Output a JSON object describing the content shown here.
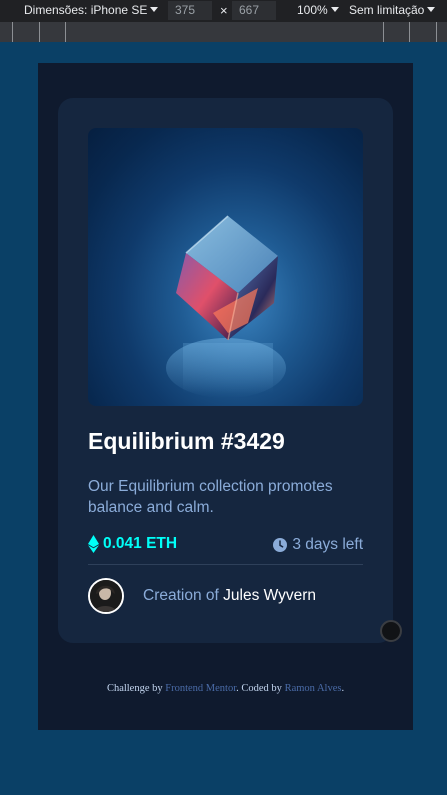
{
  "toolbar": {
    "dimensions_label": "Dimensões: iPhone SE",
    "width_value": "375",
    "times_symbol": "×",
    "height_value": "667",
    "zoom_label": "100%",
    "throttle_label": "Sem limitação"
  },
  "card": {
    "title": "Equilibrium #3429",
    "description": "Our Equilibrium collection promotes balance and calm.",
    "price": "0.041 ETH",
    "time_left": "3 days left",
    "creator_prefix": "Creation of",
    "creator_name": "Jules Wyvern"
  },
  "footer": {
    "prefix": "Challenge by",
    "challenge_link": "Frontend Mentor",
    "middle": ". Coded by",
    "author_link": "Ramon Alves",
    "suffix": "."
  },
  "colors": {
    "page_bg": "#0a4066",
    "main_bg": "#0f1a2e",
    "card_bg": "#15263f",
    "cyan": "#00fff8",
    "soft_blue": "#8bacd9",
    "white": "#ffffff"
  },
  "icons": [
    "ethereum-icon",
    "clock-icon",
    "dropdown-caret-icon"
  ]
}
